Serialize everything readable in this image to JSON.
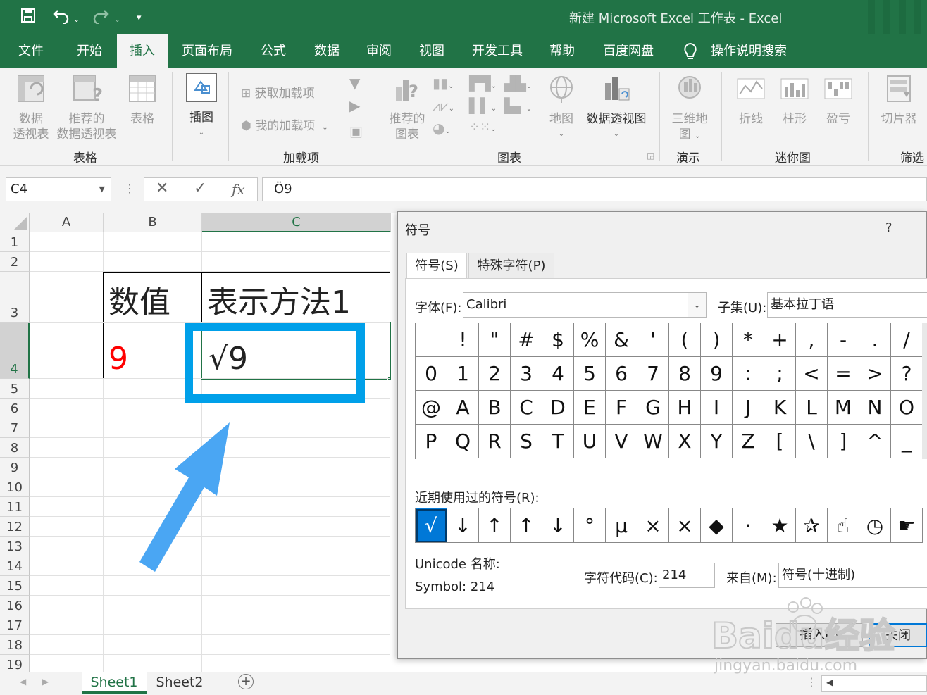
{
  "window": {
    "title": "新建 Microsoft Excel 工作表  -  Excel"
  },
  "ribbon_tabs": [
    {
      "label": "文件"
    },
    {
      "label": "开始"
    },
    {
      "label": "插入"
    },
    {
      "label": "页面布局"
    },
    {
      "label": "公式"
    },
    {
      "label": "数据"
    },
    {
      "label": "审阅"
    },
    {
      "label": "视图"
    },
    {
      "label": "开发工具"
    },
    {
      "label": "帮助"
    },
    {
      "label": "百度网盘"
    },
    {
      "label": "操作说明搜索"
    }
  ],
  "active_tab": "插入",
  "ribbon": {
    "groups": {
      "tables": "表格",
      "addins": "加载项",
      "charts": "图表",
      "tours": "演示",
      "sparklines": "迷你图",
      "filters": "筛选"
    },
    "buttons": {
      "pivot_line1": "数据",
      "pivot_line2": "透视表",
      "rec_pivot_line1": "推荐的",
      "rec_pivot_line2": "数据透视表",
      "table": "表格",
      "illustrations": "插图",
      "get_addins": "获取加载项",
      "my_addins": "我的加载项",
      "rec_charts_line1": "推荐的",
      "rec_charts_line2": "图表",
      "maps": "地图",
      "pivot_chart": "数据透视图",
      "map3d_line1": "三维地",
      "map3d_line2": "图",
      "spark_line": "折线",
      "spark_column": "柱形",
      "spark_winloss": "盈亏",
      "slicer": "切片器"
    }
  },
  "formula_bar": {
    "name_box": "C4",
    "cancel_symbol": "✕",
    "enter_symbol": "✓",
    "fx_symbol": "fx",
    "content": "Ö9"
  },
  "grid": {
    "columns": [
      "A",
      "B",
      "C"
    ],
    "rows": [
      "1",
      "2",
      "3",
      "4",
      "5",
      "6",
      "7",
      "8",
      "9",
      "10",
      "11",
      "12",
      "13",
      "14",
      "15",
      "16",
      "17",
      "18",
      "19"
    ],
    "cells": {
      "B3": "数值",
      "C3": "表示方法1",
      "B4": "9",
      "C4": "√9"
    },
    "value_color": "#ff0000",
    "highlight_color": "#00a0e9"
  },
  "sheets": [
    {
      "label": "Sheet1"
    },
    {
      "label": "Sheet2"
    }
  ],
  "dialog": {
    "title": "符号",
    "help": "?",
    "tabs": [
      "符号(S)",
      "特殊字符(P)"
    ],
    "font_label": "字体(F):",
    "font_value": "Calibri",
    "subset_label": "子集(U):",
    "subset_value": "基本拉丁语",
    "symbols": [
      " ",
      "!",
      "\"",
      "#",
      "$",
      "%",
      "&",
      "'",
      "(",
      ")",
      "*",
      "+",
      ",",
      "-",
      ".",
      "/",
      "0",
      "1",
      "2",
      "3",
      "4",
      "5",
      "6",
      "7",
      "8",
      "9",
      ":",
      ";",
      "<",
      "=",
      ">",
      "?",
      "@",
      "A",
      "B",
      "C",
      "D",
      "E",
      "F",
      "G",
      "H",
      "I",
      "J",
      "K",
      "L",
      "M",
      "N",
      "O",
      "P",
      "Q",
      "R",
      "S",
      "T",
      "U",
      "V",
      "W",
      "X",
      "Y",
      "Z",
      "[",
      "\\",
      "]",
      "^",
      "_"
    ],
    "recent_label": "近期使用过的符号(R):",
    "recent": [
      "√",
      "↓",
      "↑",
      "↑",
      "↓",
      "°",
      "μ",
      "×",
      "×",
      "◆",
      "·",
      "★",
      "✰",
      "☝",
      "◷",
      "☛"
    ],
    "unicode_name_label": "Unicode 名称:",
    "symbol_name": "Symbol: 214",
    "char_code_label": "字符代码(C):",
    "char_code": "214",
    "from_label": "来自(M):",
    "from_value": "符号(十进制)",
    "insert_button": "插入(I)",
    "close_button": "关闭"
  },
  "watermark": {
    "brand": "Baidu经验",
    "url": "jingyan.baidu.com"
  }
}
